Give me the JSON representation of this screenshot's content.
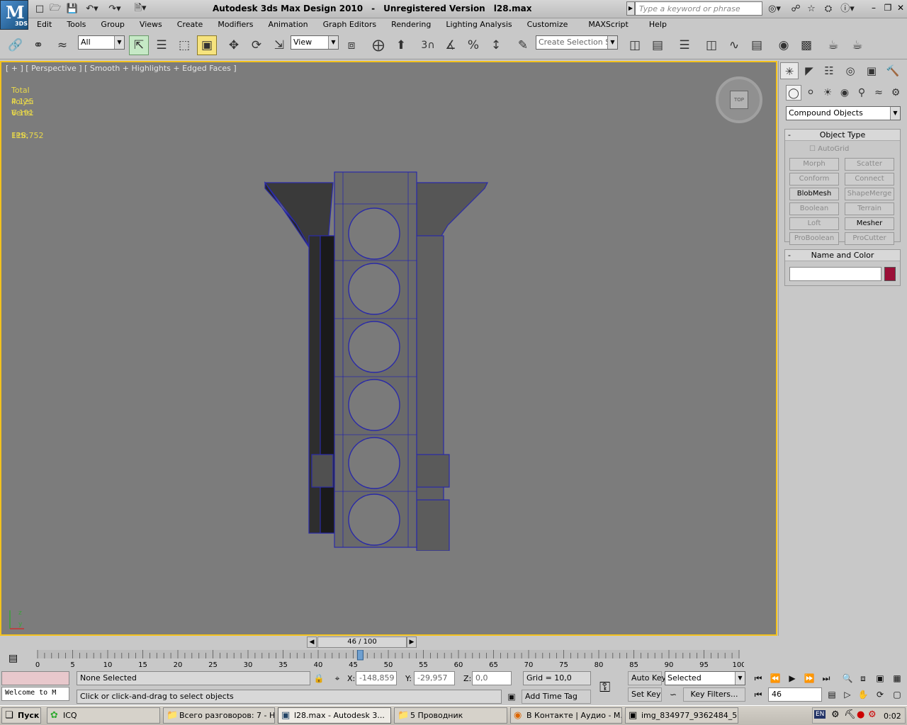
{
  "title": {
    "app": "Autodesk 3ds Max Design 2010",
    "version": "Unregistered Version",
    "file": "l28.max"
  },
  "logo": {
    "letter": "M",
    "sub": "3DS"
  },
  "search": {
    "placeholder": "Type a keyword or phrase"
  },
  "menu": [
    "Edit",
    "Tools",
    "Group",
    "Views",
    "Create",
    "Modifiers",
    "Animation",
    "Graph Editors",
    "Rendering",
    "Lighting Analysis",
    "Customize",
    "MAXScript",
    "Help"
  ],
  "toolbar": {
    "filter": "All",
    "refcoord": "View",
    "snap_num": "3",
    "selection_set_placeholder": "Create Selection Se"
  },
  "viewport": {
    "label": "[ + ] [ Perspective ] [ Smooth + Highlights + Edged Faces ]",
    "stats": {
      "total_label": "Total",
      "polys_label": "Polys:",
      "polys": "4 125",
      "verts_label": "Verts:",
      "verts": "6 191",
      "fps_label": "FPS:",
      "fps": "118,752"
    },
    "axis": {
      "z": "z",
      "y": "y",
      "x": "x"
    },
    "cube_label": "TOP"
  },
  "cmd_panel": {
    "category": "Compound Objects",
    "object_type": {
      "title": "Object Type",
      "autogrid": "AutoGrid",
      "buttons": [
        {
          "label": "Morph",
          "enabled": false
        },
        {
          "label": "Scatter",
          "enabled": false
        },
        {
          "label": "Conform",
          "enabled": false
        },
        {
          "label": "Connect",
          "enabled": false
        },
        {
          "label": "BlobMesh",
          "enabled": true
        },
        {
          "label": "ShapeMerge",
          "enabled": false
        },
        {
          "label": "Boolean",
          "enabled": false
        },
        {
          "label": "Terrain",
          "enabled": false
        },
        {
          "label": "Loft",
          "enabled": false
        },
        {
          "label": "Mesher",
          "enabled": true
        },
        {
          "label": "ProBoolean",
          "enabled": false
        },
        {
          "label": "ProCutter",
          "enabled": false
        }
      ]
    },
    "name_color": {
      "title": "Name and Color",
      "name": "",
      "color": "#9b0f37"
    }
  },
  "timeline": {
    "frame": "46 / 100",
    "ticks": [
      "0",
      "5",
      "10",
      "15",
      "20",
      "25",
      "30",
      "35",
      "40",
      "45",
      "50",
      "55",
      "60",
      "65",
      "70",
      "75",
      "80",
      "85",
      "90",
      "95",
      "100"
    ],
    "current": 46,
    "max": 100
  },
  "status": {
    "selection": "None Selected",
    "prompt": "Click or click-and-drag to select objects",
    "listener": "Welcome to M",
    "x_label": "X:",
    "x": "-148,859",
    "y_label": "Y:",
    "y": "-29,957",
    "z_label": "Z:",
    "z": "0,0",
    "grid": "Grid = 10,0",
    "add_time_tag": "Add Time Tag",
    "auto_key": "Auto Key",
    "set_key": "Set Key",
    "key_mode": "Selected",
    "key_filters": "Key Filters...",
    "frame_field": "46"
  },
  "taskbar": {
    "start": "Пуск",
    "tasks": [
      "ICQ",
      "Всего разговоров: 7 - Н...",
      "l28.max - Autodesk 3...",
      "5 Проводник",
      "В Контакте | Аудио - M...",
      "img_834977_9362484_5..."
    ],
    "lang": "EN",
    "clock": "0:02"
  },
  "colors": {
    "accent": "#f3c21d",
    "viewport_bg": "#7c7c7c",
    "wire": "#2a2aa8",
    "stats": "#e8d84a"
  }
}
